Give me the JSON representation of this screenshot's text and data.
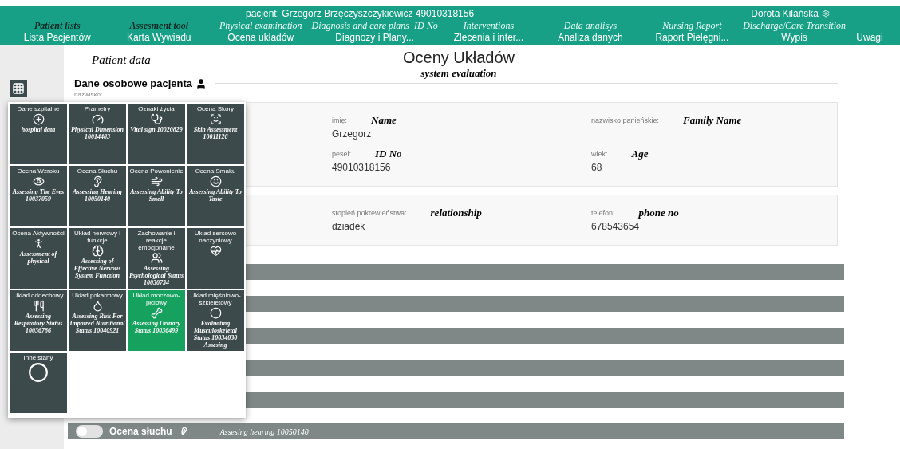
{
  "nav": {
    "patient": "pacjent: Grzegorz Brzęczyszczykiewicz 49010318156",
    "user": "Dorota Kilańska",
    "items": [
      {
        "label": "Lista Pacjentów",
        "notes": [
          "Patient lists"
        ]
      },
      {
        "label": "Karta Wywiadu",
        "notes": [
          "Assesment tool"
        ]
      },
      {
        "label": "Ocena układów",
        "notes": [
          "Physical examination"
        ]
      },
      {
        "label": "Diagnozy i Plany...",
        "notes": [
          "Diagnosis and care plans",
          "ID No"
        ]
      },
      {
        "label": "Zlecenia i inter...",
        "notes": [
          "Interventions"
        ]
      },
      {
        "label": "Analiza danych",
        "notes": [
          "Data analisys"
        ]
      },
      {
        "label": "Raport Pielęgni...",
        "notes": [
          "Nursing Report"
        ]
      },
      {
        "label": "Wypis",
        "notes": [
          "Discharge/Care Transition"
        ]
      },
      {
        "label": "Uwagi"
      }
    ]
  },
  "page": {
    "side_title": "Patient data",
    "title": "Oceny Układów",
    "subtitle": "system evaluation"
  },
  "personal": {
    "heading": "Dane osobowe pacjenta",
    "surname_label": "nazwisko:",
    "cards": [
      {
        "fields": [
          {
            "label": "imię:",
            "note": "Name",
            "value": "Grzegorz"
          },
          {
            "label": "nazwisko panieńskie:",
            "note": "Family Name"
          },
          {
            "label": "pesel:",
            "note": "ID No",
            "value": "49010318156"
          },
          {
            "label": "wiek:",
            "note": "Age",
            "value": "68"
          }
        ]
      },
      {
        "fields": [
          {
            "label": "stopień pokrewieństwa:",
            "note": "relationship",
            "value": "dziadek"
          },
          {
            "label": "telefon:",
            "note": "phone no",
            "value": "678543654"
          }
        ]
      }
    ]
  },
  "sections": [
    {
      "kind": "bar"
    },
    {
      "kind": "bar"
    },
    {
      "kind": "bar"
    },
    {
      "kind": "bar"
    },
    {
      "kind": "bar"
    },
    {
      "kind": "titled",
      "title": "Ocena słuchu",
      "note": "Assesing hearing 10050140",
      "on": false
    }
  ],
  "tile_menu": {
    "tiles": [
      {
        "label": "Dane szpitalne",
        "note": "hospital data",
        "selected": false
      },
      {
        "label": "Prametry",
        "note": "Physical Dimension 10014483",
        "selected": false
      },
      {
        "label": "Oznaki życia",
        "note": "Vital sign 10020829",
        "selected": false
      },
      {
        "label": "Ocena Skóry",
        "note": "Skin Assessment 10011126",
        "selected": false
      },
      {
        "label": "Ocena Wzroku",
        "note": "Assessing The Eyes 10037059",
        "selected": false
      },
      {
        "label": "Ocena Słuchu",
        "note": "Assessing Hearing 10050140",
        "selected": false
      },
      {
        "label": "Ocena Powonienie",
        "note": "Assessing Ability To Smell",
        "selected": false
      },
      {
        "label": "Ocena Smaku",
        "note": "Assessing Ability To Taste",
        "selected": false
      },
      {
        "label": "Ocena Aktywności",
        "note": "Assessment of physical",
        "selected": false
      },
      {
        "label": "Układ nerwowy i funkcje",
        "note": "Assessing of Effective Nervous System Function",
        "selected": false
      },
      {
        "label": "Zachowanie i reakcje emocjonalne",
        "note": "Assessing Psychological Status 10030734",
        "selected": false
      },
      {
        "label": "Układ sercowo naczyniowy",
        "selected": false
      },
      {
        "label": "Układ oddechowy",
        "note": "Assessing Respiratory Status 10036786",
        "selected": false
      },
      {
        "label": "Układ pokarmowy",
        "note": "Assessing Risk For Impaired Nutritional Status 10040921",
        "selected": false
      },
      {
        "label": "Układ moczowo-płciowy",
        "note": "Assessing Urinary Status 10036499",
        "selected": true
      },
      {
        "label": "Układ mięśniowo-szkieletowy",
        "note": "Evaluating Musculoskeletal Status 10034030 Assesing",
        "selected": false
      },
      {
        "label": "Inne stany",
        "selected": false
      }
    ]
  }
}
